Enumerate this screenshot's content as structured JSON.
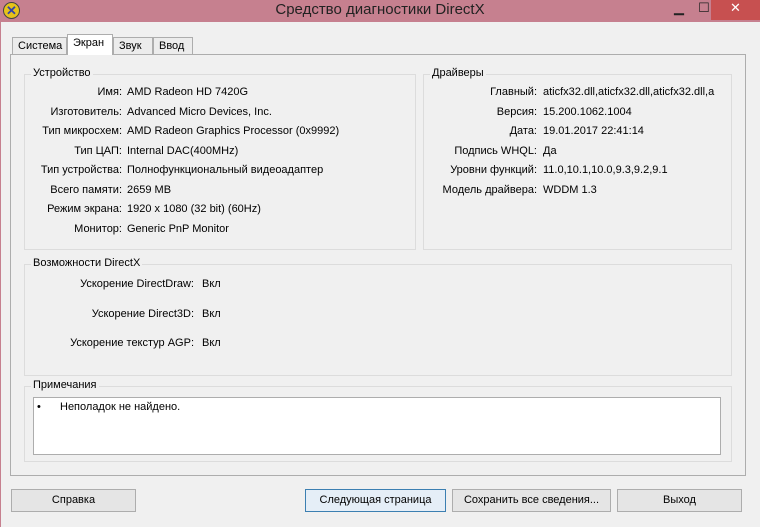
{
  "window": {
    "title": "Средство диагностики DirectX",
    "minimize": "▁",
    "maximize": "☐",
    "close": "✕"
  },
  "tabs": [
    {
      "label": "Система"
    },
    {
      "label": "Экран"
    },
    {
      "label": "Звук"
    },
    {
      "label": "Ввод"
    }
  ],
  "device": {
    "title": "Устройство",
    "rows": [
      {
        "label": "Имя:",
        "value": "AMD Radeon HD 7420G"
      },
      {
        "label": "Изготовитель:",
        "value": "Advanced Micro Devices, Inc."
      },
      {
        "label": "Тип микросхем:",
        "value": "AMD Radeon Graphics Processor (0x9992)"
      },
      {
        "label": "Тип ЦАП:",
        "value": "Internal DAC(400MHz)"
      },
      {
        "label": "Тип устройства:",
        "value": "Полнофункциональный видеоадаптер"
      },
      {
        "label": "Всего памяти:",
        "value": "2659 MB"
      },
      {
        "label": "Режим экрана:",
        "value": "1920 x 1080 (32 bit) (60Hz)"
      },
      {
        "label": "Монитор:",
        "value": "Generic PnP Monitor"
      }
    ]
  },
  "drivers": {
    "title": "Драйверы",
    "rows": [
      {
        "label": "Главный:",
        "value": "aticfx32.dll,aticfx32.dll,aticfx32.dll,a"
      },
      {
        "label": "Версия:",
        "value": "15.200.1062.1004"
      },
      {
        "label": "Дата:",
        "value": "19.01.2017 22:41:14"
      },
      {
        "label": "Подпись WHQL:",
        "value": "Да"
      },
      {
        "label": "Уровни функций:",
        "value": "11.0,10.1,10.0,9.3,9.2,9.1"
      },
      {
        "label": "Модель драйвера:",
        "value": "WDDM 1.3"
      }
    ]
  },
  "directx": {
    "title": "Возможности DirectX",
    "rows": [
      {
        "label": "Ускорение DirectDraw:",
        "value": "Вкл"
      },
      {
        "label": "Ускорение Direct3D:",
        "value": "Вкл"
      },
      {
        "label": "Ускорение текстур AGP:",
        "value": "Вкл"
      }
    ]
  },
  "notes": {
    "title": "Примечания",
    "items": [
      "Неполадок не найдено."
    ]
  },
  "buttons": {
    "help": "Справка",
    "next": "Следующая страница",
    "save": "Сохранить все сведения...",
    "exit": "Выход"
  }
}
